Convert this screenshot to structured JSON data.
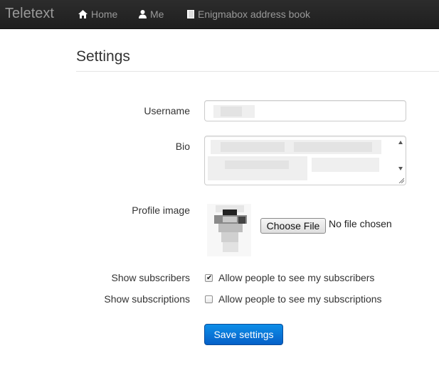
{
  "navbar": {
    "brand": "Teletext",
    "items": [
      {
        "label": "Home",
        "icon": "home-icon"
      },
      {
        "label": "Me",
        "icon": "user-icon"
      },
      {
        "label": "Enigmabox address book",
        "icon": "book-icon"
      }
    ]
  },
  "page": {
    "title": "Settings"
  },
  "form": {
    "username_label": "Username",
    "bio_label": "Bio",
    "profile_image_label": "Profile image",
    "file_button_label": "Choose File",
    "file_status": "No file chosen",
    "show_subscribers_label": "Show subscribers",
    "show_subscribers_option": "Allow people to see my subscribers",
    "show_subscribers_checked": true,
    "show_subscriptions_label": "Show subscriptions",
    "show_subscriptions_option": "Allow people to see my subscriptions",
    "show_subscriptions_checked": false,
    "save_button_label": "Save settings"
  },
  "colors": {
    "navbar_bg": "#222222",
    "nav_text": "#999999",
    "primary_button": "#0e75d9"
  }
}
